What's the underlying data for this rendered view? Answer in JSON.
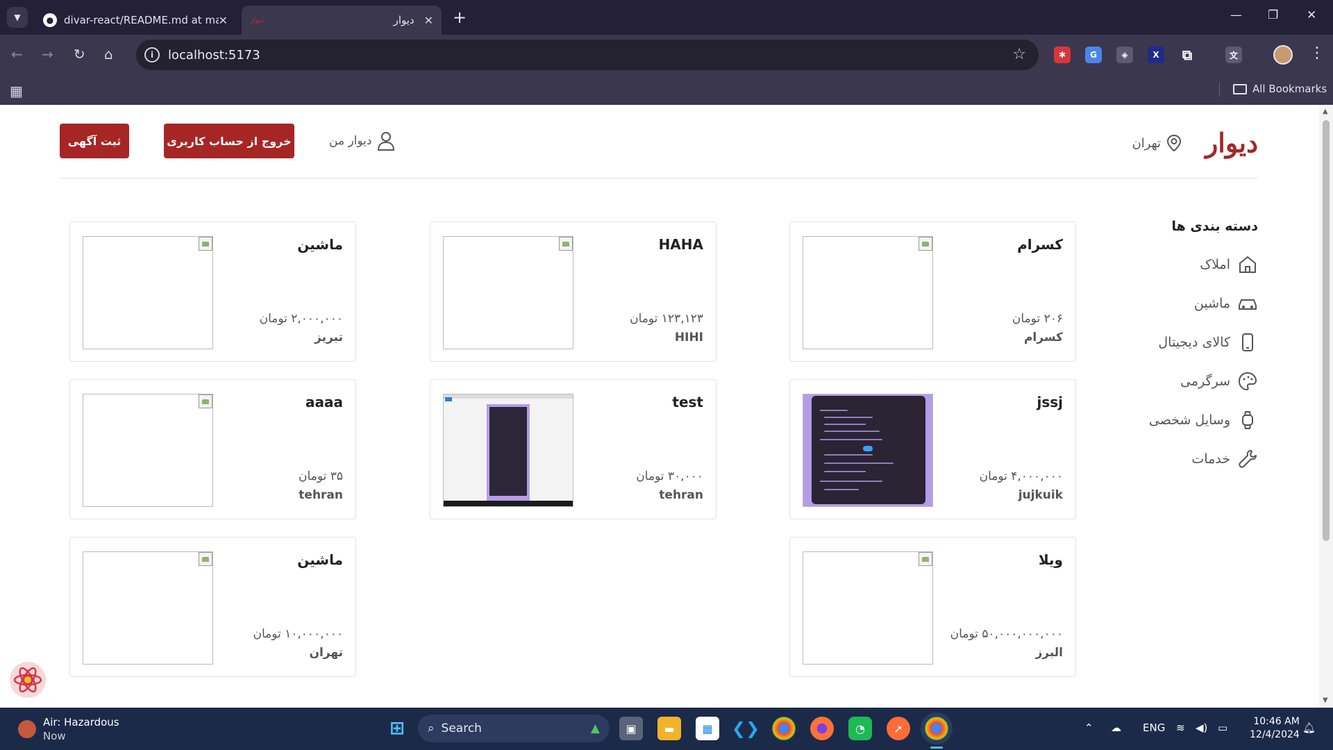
{
  "browser": {
    "tabs": [
      {
        "title": "divar-react/README.md at mai",
        "active": false
      },
      {
        "title": "دیوار",
        "active": true
      }
    ],
    "url": "localhost:5173",
    "bookmarks_label": "All Bookmarks"
  },
  "header": {
    "logo": "دیوار",
    "city": "تهران",
    "my_divar": "دیوار من",
    "logout_button": "خروج از حساب کاربری",
    "post_ad_button": "ثبت آگهی"
  },
  "sidebar": {
    "title": "دسته بندی ها",
    "items": [
      {
        "label": "املاک",
        "icon": "home-icon"
      },
      {
        "label": "ماشین",
        "icon": "car-icon"
      },
      {
        "label": "کالای دیجیتال",
        "icon": "phone-icon"
      },
      {
        "label": "سرگرمی",
        "icon": "palette-icon"
      },
      {
        "label": "وسایل شخصی",
        "icon": "watch-icon"
      },
      {
        "label": "خدمات",
        "icon": "wrench-icon"
      }
    ]
  },
  "ads": [
    {
      "title": "کسرام",
      "price": "۲۰۶ تومان",
      "location": "کسرام",
      "image": "broken"
    },
    {
      "title": "HAHA",
      "price": "۱۲۳,۱۲۳ تومان",
      "location": "HIHI",
      "image": "broken"
    },
    {
      "title": "ماشین",
      "price": "۲,۰۰۰,۰۰۰ تومان",
      "location": "تبریز",
      "image": "broken"
    },
    {
      "title": "jssj",
      "price": "۴,۰۰۰,۰۰۰ تومان",
      "location": "jujkuik",
      "image": "code-screenshot"
    },
    {
      "title": "test",
      "price": "۳۰,۰۰۰ تومان",
      "location": "tehran",
      "image": "web-screenshot"
    },
    {
      "title": "aaaa",
      "price": "۳۵ تومان",
      "location": "tehran",
      "image": "broken"
    },
    {
      "title": "ویلا",
      "price": "۵۰,۰۰۰,۰۰۰,۰۰۰ تومان",
      "location": "البرز",
      "image": "broken"
    },
    {
      "title": "ماشین",
      "price": "۱۰,۰۰۰,۰۰۰ تومان",
      "location": "تهران",
      "image": "broken"
    }
  ],
  "taskbar": {
    "weather_title": "Air: Hazardous",
    "weather_sub": "Now",
    "search_placeholder": "Search",
    "language": "ENG",
    "time": "10:46 AM",
    "date": "12/4/2024"
  },
  "colors": {
    "brand": "#a62626",
    "chrome_dark": "#232038",
    "chrome_toolbar": "#3b374f",
    "taskbar": "#1c2a4a"
  }
}
